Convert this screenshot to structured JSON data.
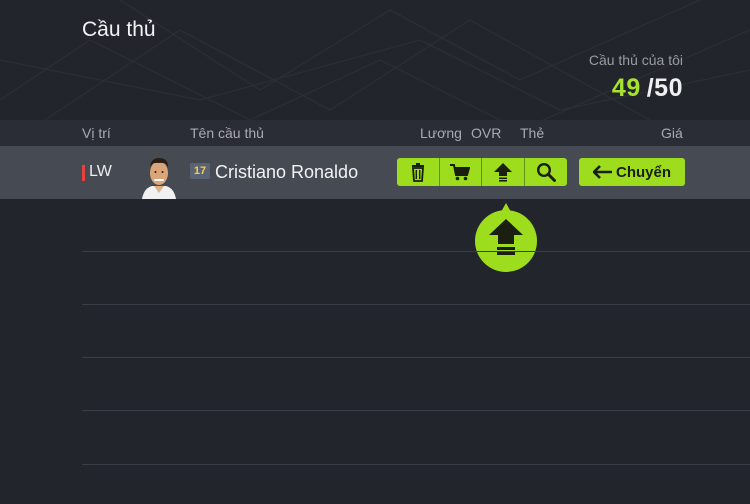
{
  "page": {
    "title": "Cầu thủ"
  },
  "my_players": {
    "label": "Cầu thủ của tôi",
    "current": "49",
    "max": "/50"
  },
  "columns": {
    "position": "Vị trí",
    "name": "Tên cầu thủ",
    "salary": "Lương",
    "ovr": "OVR",
    "card": "Thẻ",
    "price": "Giá"
  },
  "player": {
    "position": "LW",
    "season": "17",
    "name": "Cristiano Ronaldo"
  },
  "actions": [
    "trash-icon",
    "cart-icon",
    "upgrade-arrow-icon",
    "search-icon"
  ],
  "transfer_label": "Chuyển",
  "colors": {
    "accent": "#9ddd1e",
    "position_marker": "#e8423f",
    "count_highlight": "#a6e22e"
  }
}
